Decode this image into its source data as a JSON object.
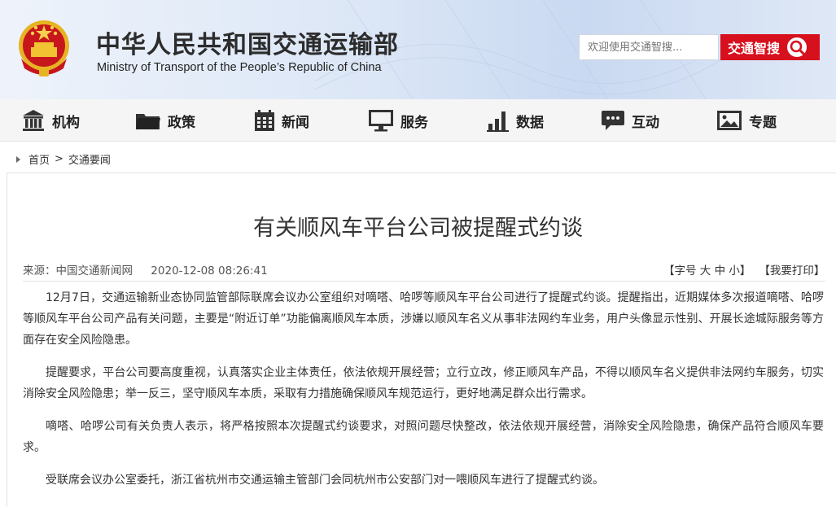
{
  "header": {
    "title_cn": "中华人民共和国交通运输部",
    "title_en": "Ministry of Transport of the People’s Republic of China",
    "search_placeholder": "欢迎使用交通智搜...",
    "search_button": "交通智搜"
  },
  "nav": {
    "items": [
      {
        "label": "机构",
        "icon": "building-icon"
      },
      {
        "label": "政策",
        "icon": "folder-icon"
      },
      {
        "label": "新闻",
        "icon": "calendar-icon"
      },
      {
        "label": "服务",
        "icon": "monitor-icon"
      },
      {
        "label": "数据",
        "icon": "bar-chart-icon"
      },
      {
        "label": "互动",
        "icon": "chat-bubble-icon"
      },
      {
        "label": "专题",
        "icon": "image-icon"
      }
    ]
  },
  "breadcrumb": {
    "home": "首页",
    "separator": ">",
    "current": "交通要闻"
  },
  "article": {
    "title": "有关顺风车平台公司被提醒式约谈",
    "source": "来源：中国交通新闻网",
    "date": "2020-12-08 08:26:41",
    "tools": {
      "open_bracket": "【",
      "font_size_label": "字号",
      "large": "大",
      "medium": "中",
      "small": "小",
      "close_bracket": "】",
      "print": "【我要打印】"
    },
    "paragraphs": [
      "12月7日，交通运输新业态协同监管部际联席会议办公室组织对嘀嗒、哈啰等顺风车平台公司进行了提醒式约谈。提醒指出，近期媒体多次报道嘀嗒、哈啰等顺风车平台公司产品有关问题，主要是“附近订单”功能偏离顺风车本质，涉嫌以顺风车名义从事非法网约车业务，用户头像显示性别、开展长途城际服务等方面存在安全风险隐患。",
      "提醒要求，平台公司要高度重视，认真落实企业主体责任，依法依规开展经营；立行立改，修正顺风车产品，不得以顺风车名义提供非法网约车服务，切实消除安全风险隐患；举一反三，坚守顺风车本质，采取有力措施确保顺风车规范运行，更好地满足群众出行需求。",
      "嘀嗒、哈啰公司有关负责人表示，将严格按照本次提醒式约谈要求，对照问题尽快整改，依法依规开展经营，消除安全风险隐患，确保产品符合顺风车要求。",
      "受联席会议办公室委托，浙江省杭州市交通运输主管部门会同杭州市公安部门对一喂顺风车进行了提醒式约谈。"
    ]
  },
  "colors": {
    "brand_red": "#d7101e",
    "nav_bg": "#f5f5f5",
    "header_blue": "#c9d9f1"
  }
}
